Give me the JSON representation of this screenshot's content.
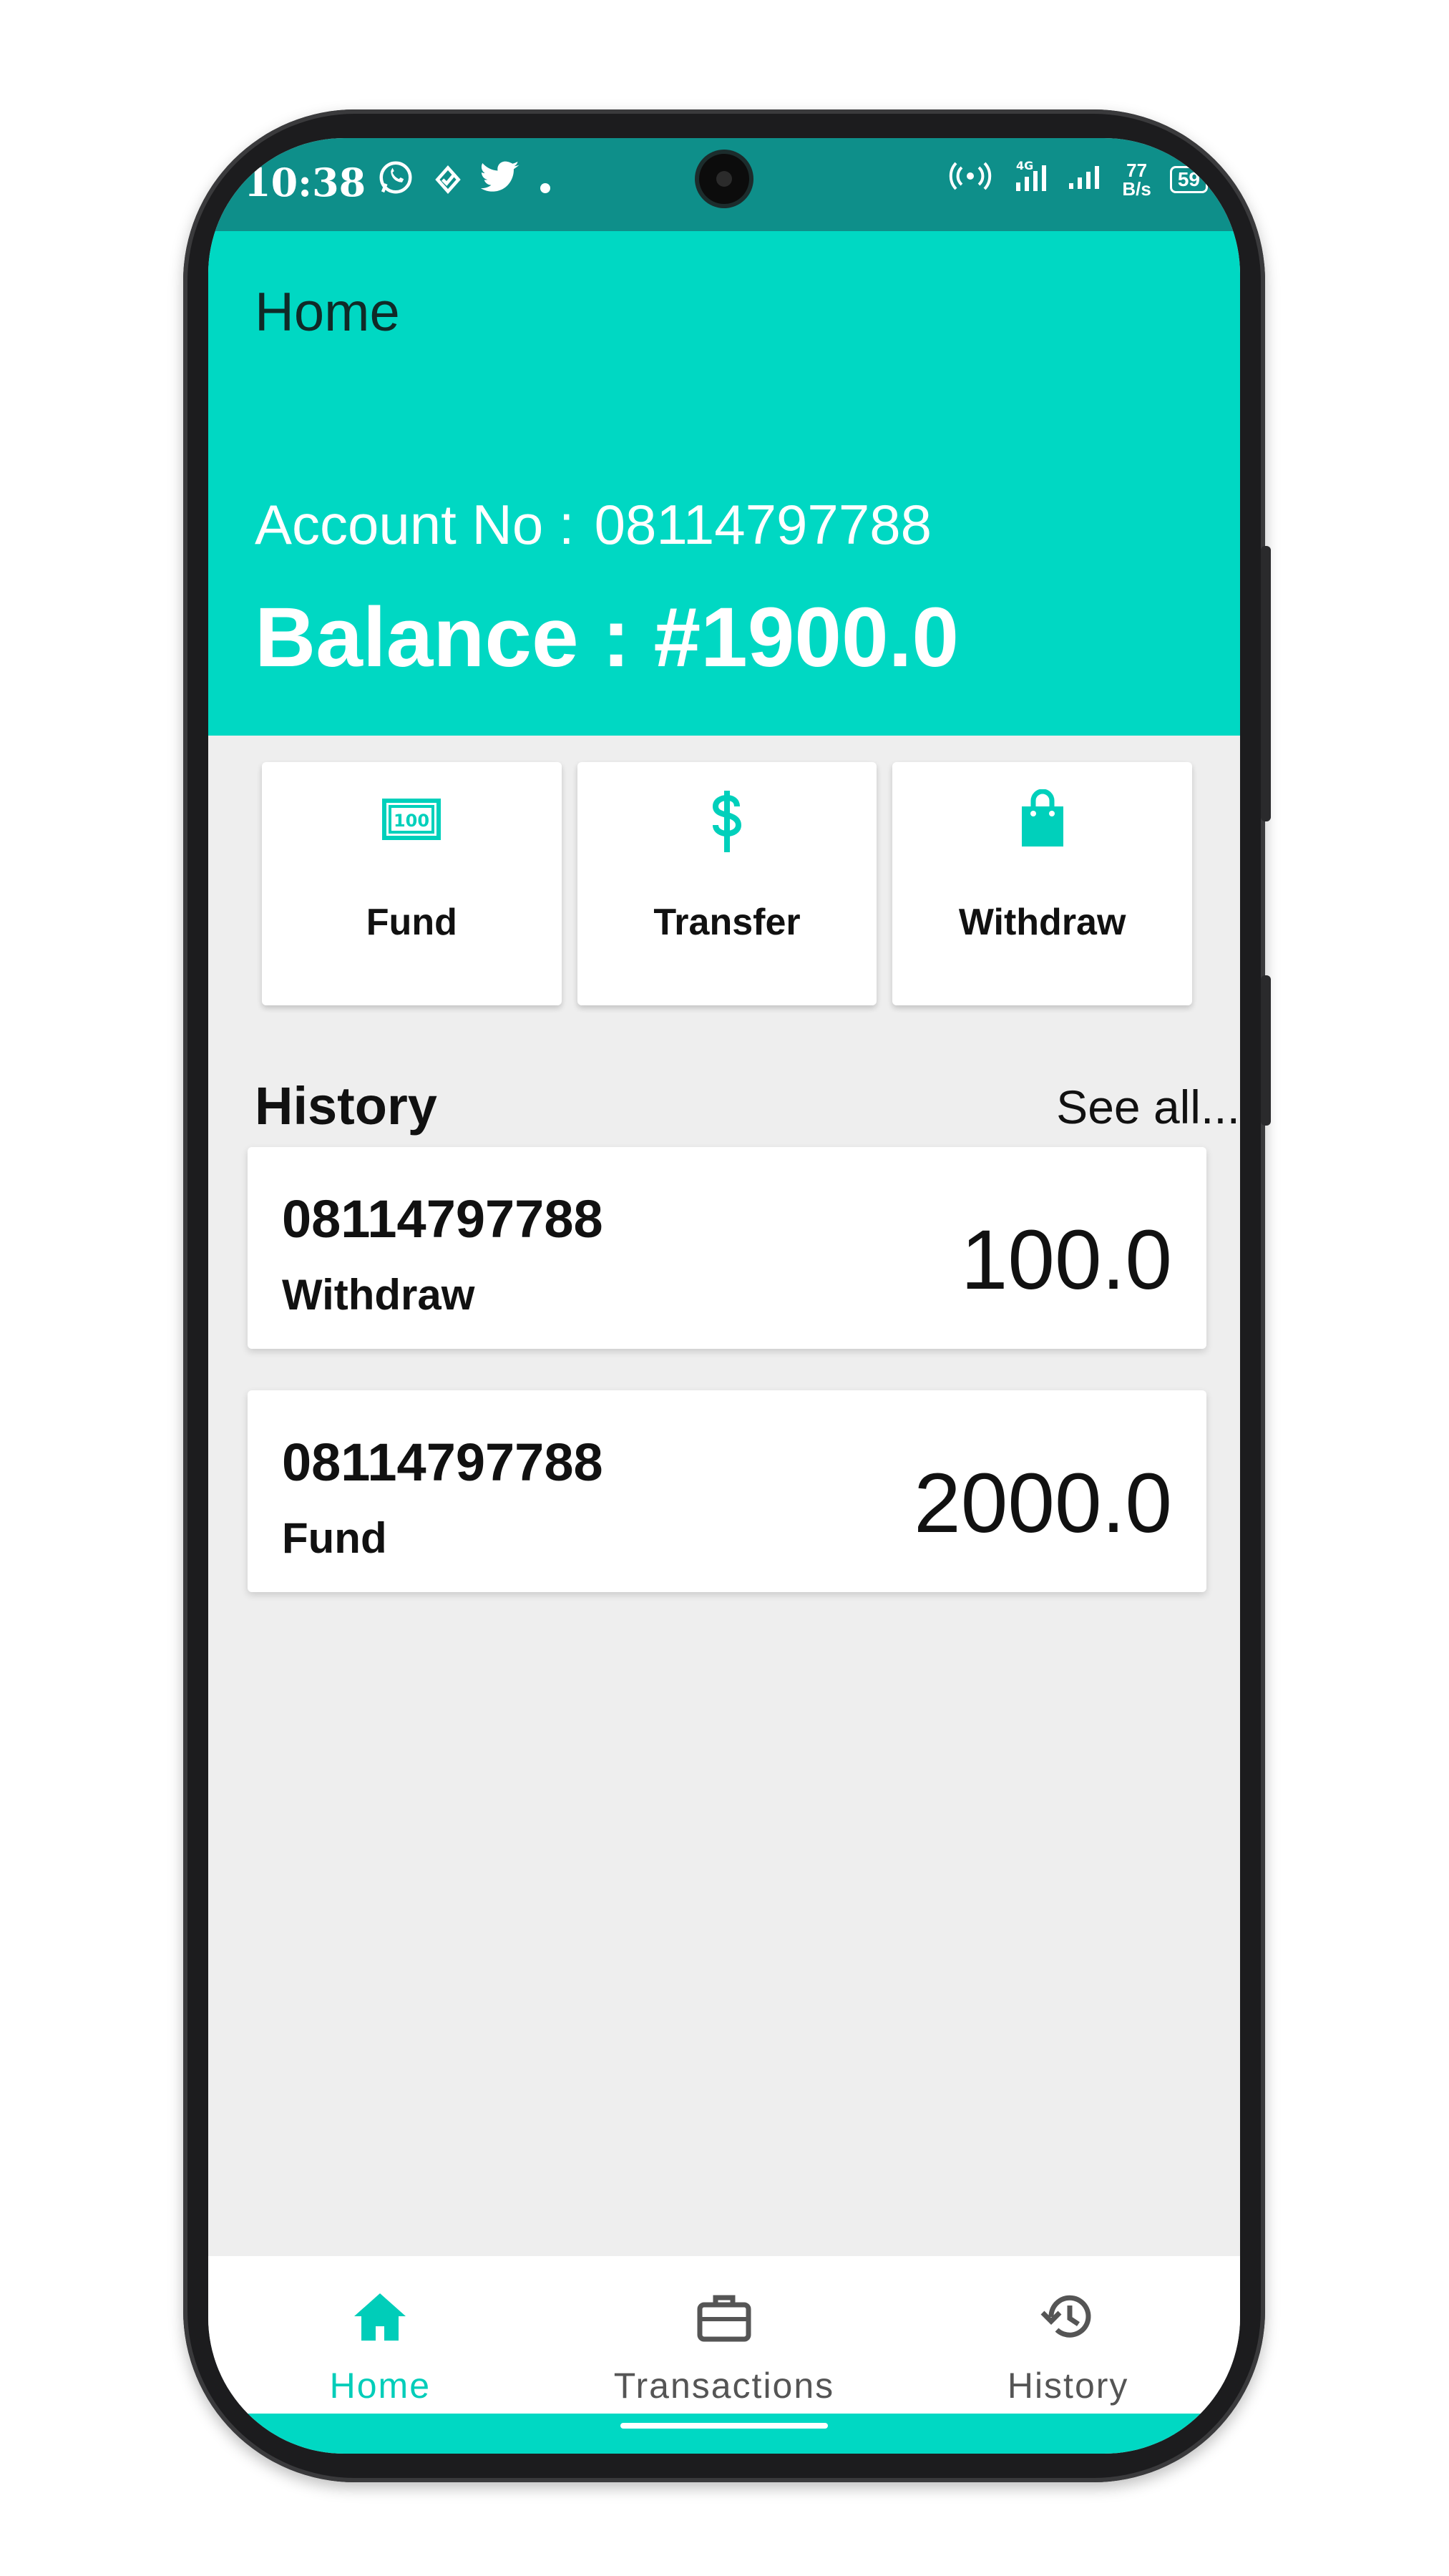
{
  "status_bar": {
    "time": "10:38",
    "net_speed_value": "77",
    "net_speed_unit": "B/s",
    "network": "4G",
    "battery": "59"
  },
  "header": {
    "title": "Home",
    "account_label": "Account No :",
    "account_number": "08114797788",
    "balance": "Balance : #1900.0"
  },
  "actions": [
    {
      "label": "Fund",
      "icon": "banknote-icon"
    },
    {
      "label": "Transfer",
      "icon": "dollar-icon"
    },
    {
      "label": "Withdraw",
      "icon": "shopping-bag-icon"
    }
  ],
  "history": {
    "title": "History",
    "see_all": "See all...",
    "items": [
      {
        "account": "08114797788",
        "type": "Withdraw",
        "amount": "100.0"
      },
      {
        "account": "08114797788",
        "type": "Fund",
        "amount": "2000.0"
      }
    ]
  },
  "bottom_nav": [
    {
      "label": "Home",
      "icon": "home-icon",
      "active": true
    },
    {
      "label": "Transactions",
      "icon": "briefcase-icon",
      "active": false
    },
    {
      "label": "History",
      "icon": "history-icon",
      "active": false
    }
  ],
  "colors": {
    "accent": "#00d8c3",
    "status_bar": "#0e8f8a"
  }
}
